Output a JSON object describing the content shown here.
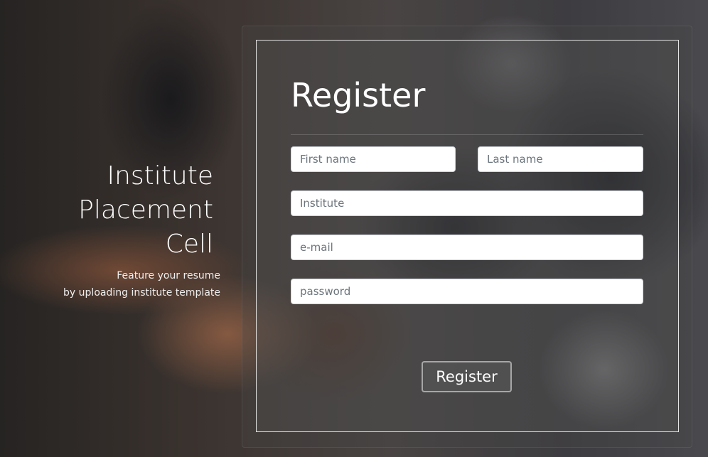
{
  "sidebar": {
    "title_lines": [
      "Institute",
      "Placement",
      "Cell"
    ],
    "subtitle_lines": [
      "Feature your resume",
      "by uploading institute template"
    ]
  },
  "form": {
    "heading": "Register",
    "fields": {
      "first_name": {
        "placeholder": "First name",
        "value": ""
      },
      "last_name": {
        "placeholder": "Last name",
        "value": ""
      },
      "institute": {
        "placeholder": "Institute",
        "value": ""
      },
      "email": {
        "placeholder": "e-mail",
        "value": ""
      },
      "password": {
        "placeholder": "password",
        "value": ""
      }
    },
    "submit_label": "Register"
  },
  "colors": {
    "text": "#ffffff",
    "panel_border": "#ffffff",
    "input_background": "#ffffff"
  }
}
